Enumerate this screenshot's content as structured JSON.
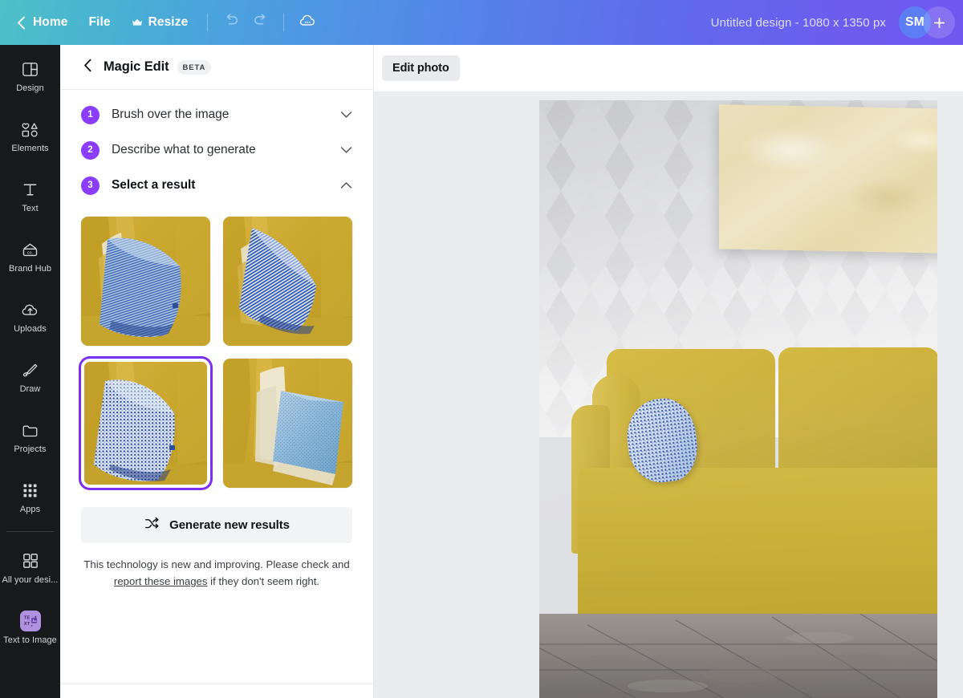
{
  "topbar": {
    "back_icon": "chevron-left-icon",
    "home_label": "Home",
    "file_label": "File",
    "resize_label": "Resize",
    "resize_crown_icon": "crown-icon",
    "undo_icon": "undo-icon",
    "redo_icon": "redo-icon",
    "cloud_icon": "cloud-saving-icon",
    "design_title": "Untitled design - 1080 x 1350 px",
    "avatar_initials": "SM",
    "add_label": "+",
    "gradient_from": "#4ec0c8",
    "gradient_to": "#7157ef"
  },
  "sidebar": {
    "items": [
      {
        "label": "Design",
        "icon": "design-icon"
      },
      {
        "label": "Elements",
        "icon": "elements-icon"
      },
      {
        "label": "Text",
        "icon": "text-icon"
      },
      {
        "label": "Brand Hub",
        "icon": "brand-hub-icon"
      },
      {
        "label": "Uploads",
        "icon": "uploads-icon"
      },
      {
        "label": "Draw",
        "icon": "draw-icon"
      },
      {
        "label": "Projects",
        "icon": "projects-icon"
      },
      {
        "label": "Apps",
        "icon": "apps-icon"
      }
    ],
    "bottom_items": [
      {
        "label": "All your desi...",
        "icon": "all-designs-icon"
      },
      {
        "label": "Text to Image",
        "icon": "text-to-image-icon"
      }
    ]
  },
  "panel": {
    "back_icon": "chevron-left-icon",
    "title": "Magic Edit",
    "badge": "BETA",
    "steps": [
      {
        "num": "1",
        "label": "Brush over the image",
        "chevron": "chevron-down-icon",
        "expanded": false
      },
      {
        "num": "2",
        "label": "Describe what to generate",
        "chevron": "chevron-down-icon",
        "expanded": false
      },
      {
        "num": "3",
        "label": "Select a result",
        "chevron": "chevron-up-icon",
        "expanded": true
      }
    ],
    "results": [
      {
        "alt": "blue striped pillow on yellow sofa result 1",
        "selected": false
      },
      {
        "alt": "blue striped pillow on yellow sofa result 2",
        "selected": false
      },
      {
        "alt": "blue dotted pillow on yellow sofa result 3",
        "selected": true
      },
      {
        "alt": "blue textured pillow on yellow sofa result 4",
        "selected": false
      }
    ],
    "generate_label": "Generate new results",
    "generate_icon": "shuffle-icon",
    "disclaimer_before": "This technology is new and improving. Please check and ",
    "disclaimer_link": "report these images",
    "disclaimer_after": " if they don't seem right.",
    "accent_color": "#8b3dff",
    "selected_border_color": "#7a2ff0"
  },
  "canvas": {
    "edit_photo_label": "Edit photo",
    "background_color": "#ebecf0",
    "photo": {
      "alt": "Living room with yellow velvet sofa, blue patterned pillow, diamond patterned wall, beige canvas artwork and grey wood floor"
    }
  }
}
